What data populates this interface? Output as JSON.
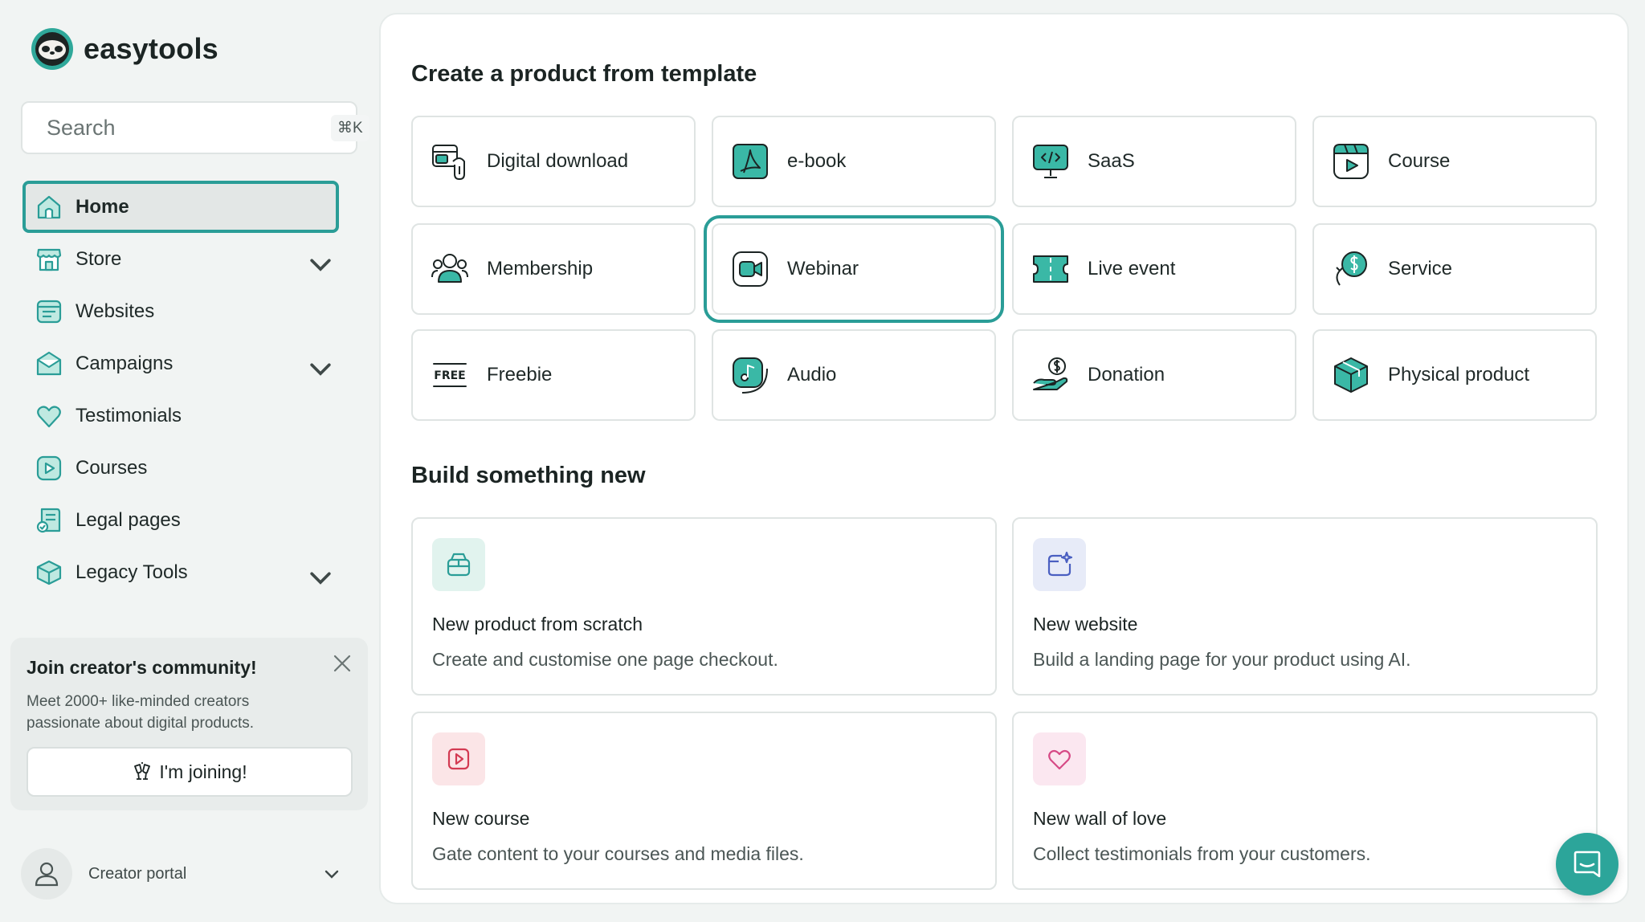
{
  "brand": {
    "name": "easytools"
  },
  "search": {
    "placeholder": "Search",
    "shortcut": "⌘K"
  },
  "nav": [
    {
      "label": "Home",
      "icon": "home-icon",
      "active": true,
      "expandable": false
    },
    {
      "label": "Store",
      "icon": "store-icon",
      "active": false,
      "expandable": true
    },
    {
      "label": "Websites",
      "icon": "websites-icon",
      "active": false,
      "expandable": false
    },
    {
      "label": "Campaigns",
      "icon": "campaigns-icon",
      "active": false,
      "expandable": true
    },
    {
      "label": "Testimonials",
      "icon": "heart-icon",
      "active": false,
      "expandable": false
    },
    {
      "label": "Courses",
      "icon": "play-icon",
      "active": false,
      "expandable": false
    },
    {
      "label": "Legal pages",
      "icon": "legal-icon",
      "active": false,
      "expandable": false
    },
    {
      "label": "Legacy Tools",
      "icon": "box-icon",
      "active": false,
      "expandable": true
    }
  ],
  "community": {
    "title": "Join creator's community!",
    "description": "Meet 2000+ like-minded creators passionate about digital products.",
    "button": "I'm joining!"
  },
  "portal": {
    "label": "Creator portal"
  },
  "templates": {
    "title": "Create a product from template",
    "items": [
      {
        "label": "Digital download",
        "icon": "digital-download-icon"
      },
      {
        "label": "e-book",
        "icon": "pdf-icon"
      },
      {
        "label": "SaaS",
        "icon": "code-monitor-icon"
      },
      {
        "label": "Course",
        "icon": "course-icon"
      },
      {
        "label": "Membership",
        "icon": "membership-icon"
      },
      {
        "label": "Webinar",
        "icon": "webinar-icon",
        "highlighted": true
      },
      {
        "label": "Live event",
        "icon": "ticket-icon"
      },
      {
        "label": "Service",
        "icon": "service-icon"
      },
      {
        "label": "Freebie",
        "icon": "free-icon"
      },
      {
        "label": "Audio",
        "icon": "audio-icon"
      },
      {
        "label": "Donation",
        "icon": "donation-icon"
      },
      {
        "label": "Physical product",
        "icon": "package-icon"
      }
    ]
  },
  "build": {
    "title": "Build something new",
    "items": [
      {
        "title": "New product from scratch",
        "description": "Create and customise one page checkout.",
        "icon": "product-box-icon"
      },
      {
        "title": "New website",
        "description": "Build a landing page for your product using AI.",
        "icon": "ai-website-icon"
      },
      {
        "title": "New course",
        "description": "Gate content to your courses and media files.",
        "icon": "video-play-icon"
      },
      {
        "title": "New wall of love",
        "description": "Collect testimonials from your customers.",
        "icon": "wall-heart-icon"
      }
    ]
  },
  "colors": {
    "accent": "#2a9d97",
    "icon_fill": "#3ab8a6",
    "chat": "#2ca59a"
  }
}
